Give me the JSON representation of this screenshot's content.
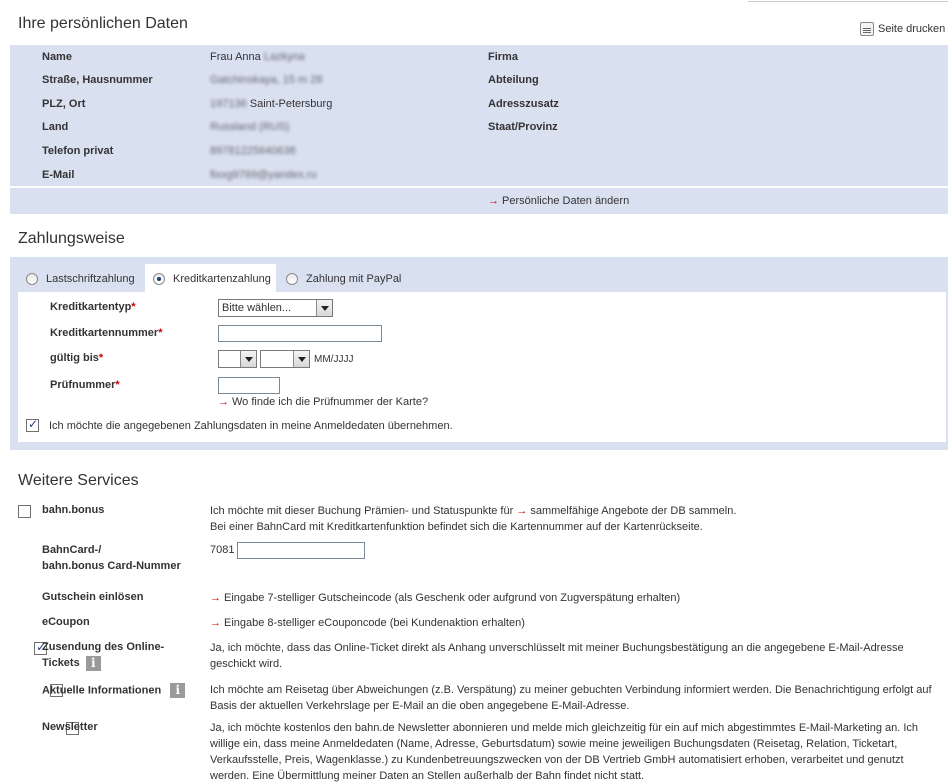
{
  "personal": {
    "title": "Ihre persönlichen Daten",
    "print_label": "Seite drucken",
    "left": [
      {
        "label": "Name",
        "value": "Frau Anna",
        "blurred": "Lazkyna"
      },
      {
        "label": "Straße, Hausnummer",
        "value": "",
        "blurred": "Gatchinskaya, 15 m 28"
      },
      {
        "label": "PLZ, Ort",
        "value": "Saint-Petersburg",
        "blurred": "197136"
      },
      {
        "label": "Land",
        "value": "",
        "blurred": "Russland (RUS)"
      },
      {
        "label": "Telefon privat",
        "value": "",
        "blurred": "89781225640638"
      },
      {
        "label": "E-Mail",
        "value": "",
        "blurred": "fixxg9769@yandex.ru"
      }
    ],
    "right": [
      {
        "label": "Firma"
      },
      {
        "label": "Abteilung"
      },
      {
        "label": "Adresszusatz"
      },
      {
        "label": "Staat/Provinz"
      }
    ],
    "change_link": "Persönliche Daten ändern"
  },
  "payment": {
    "title": "Zahlungsweise",
    "tabs": [
      {
        "label": "Lastschriftzahlung",
        "selected": false
      },
      {
        "label": "Kreditkartenzahlung",
        "selected": true
      },
      {
        "label": "Zahlung mit PayPal",
        "selected": false
      }
    ],
    "card_type_label": "Kreditkartentyp",
    "card_type_value": "Bitte wählen...",
    "card_number_label": "Kreditkartennummer",
    "card_number_value": "",
    "valid_label": "gültig bis",
    "valid_format": "MM/JJJJ",
    "cvc_label": "Prüfnummer",
    "cvc_value": "",
    "cvc_help": "Wo finde ich die Prüfnummer der Karte?",
    "req_mark": "*",
    "save_text": "Ich möchte die angegebenen Zahlungsdaten in meine Anmeldedaten übernehmen.",
    "save_checked": true
  },
  "services": {
    "title": "Weitere Services",
    "bonus_label": "bahn.bonus",
    "bonus_text_1": "Ich möchte mit dieser Buchung Prämien- und Statuspunkte für",
    "bonus_link": "sammelfähige Angebote der DB sammeln.",
    "bonus_text_2": "Bei einer BahnCard mit Kreditkartenfunktion befindet sich die Kartennummer auf der Kartenrückseite.",
    "bahncard_label_1": "BahnCard-/",
    "bahncard_label_2": "bahn.bonus Card-Nummer",
    "bahncard_prefix": "7081",
    "bahncard_value": "",
    "voucher_label": "Gutschein einlösen",
    "voucher_link": "Eingabe 7-stelliger Gutscheincode (als Geschenk oder aufgrund von Zugverspätung erhalten)",
    "ecoupon_label": "eCoupon",
    "ecoupon_link": "Eingabe 8-stelliger eCouponcode (bei Kundenaktion erhalten)",
    "online_label_1": "Zusendung des Online-",
    "online_label_2": "Tickets",
    "online_text": "Ja, ich möchte, dass das Online-Ticket direkt als Anhang unverschlüsselt mit meiner Buchungsbestätigung an die angegebene E-Mail-Adresse geschickt wird.",
    "online_checked": true,
    "news_label": "Aktuelle Informationen",
    "news_text": "Ich möchte am Reisetag über Abweichungen (z.B. Verspätung) zu meiner gebuchten Verbindung informiert werden. Die Benachrichtigung erfolgt auf Basis der aktuellen Verkehrslage per E-Mail an die oben angegebene E-Mail-Adresse.",
    "news_checked": false,
    "newsletter_label": "Newsletter",
    "newsletter_text": "Ja, ich möchte kostenlos den bahn.de Newsletter abonnieren und melde mich gleichzeitig für ein auf mich abgestimmtes E-Mail-Marketing an. Ich willige ein, dass meine Anmeldedaten (Name, Adresse, Geburtsdatum) sowie meine jeweiligen Buchungsdaten (Reisetag, Relation, Ticketart, Verkaufsstelle, Preis, Wagenklasse.) zu Kundenbetreuungszwecken von der DB Vertrieb GmbH automatisiert erhoben, verarbeitet und genutzt werden. Eine Übermittlung meiner Daten an Stellen außerhalb der Bahn findet nicht statt.",
    "newsletter_checked": false,
    "info_glyph": "i"
  },
  "colors": {
    "panel": "#d9e0f0",
    "accent": "#cc0000"
  }
}
